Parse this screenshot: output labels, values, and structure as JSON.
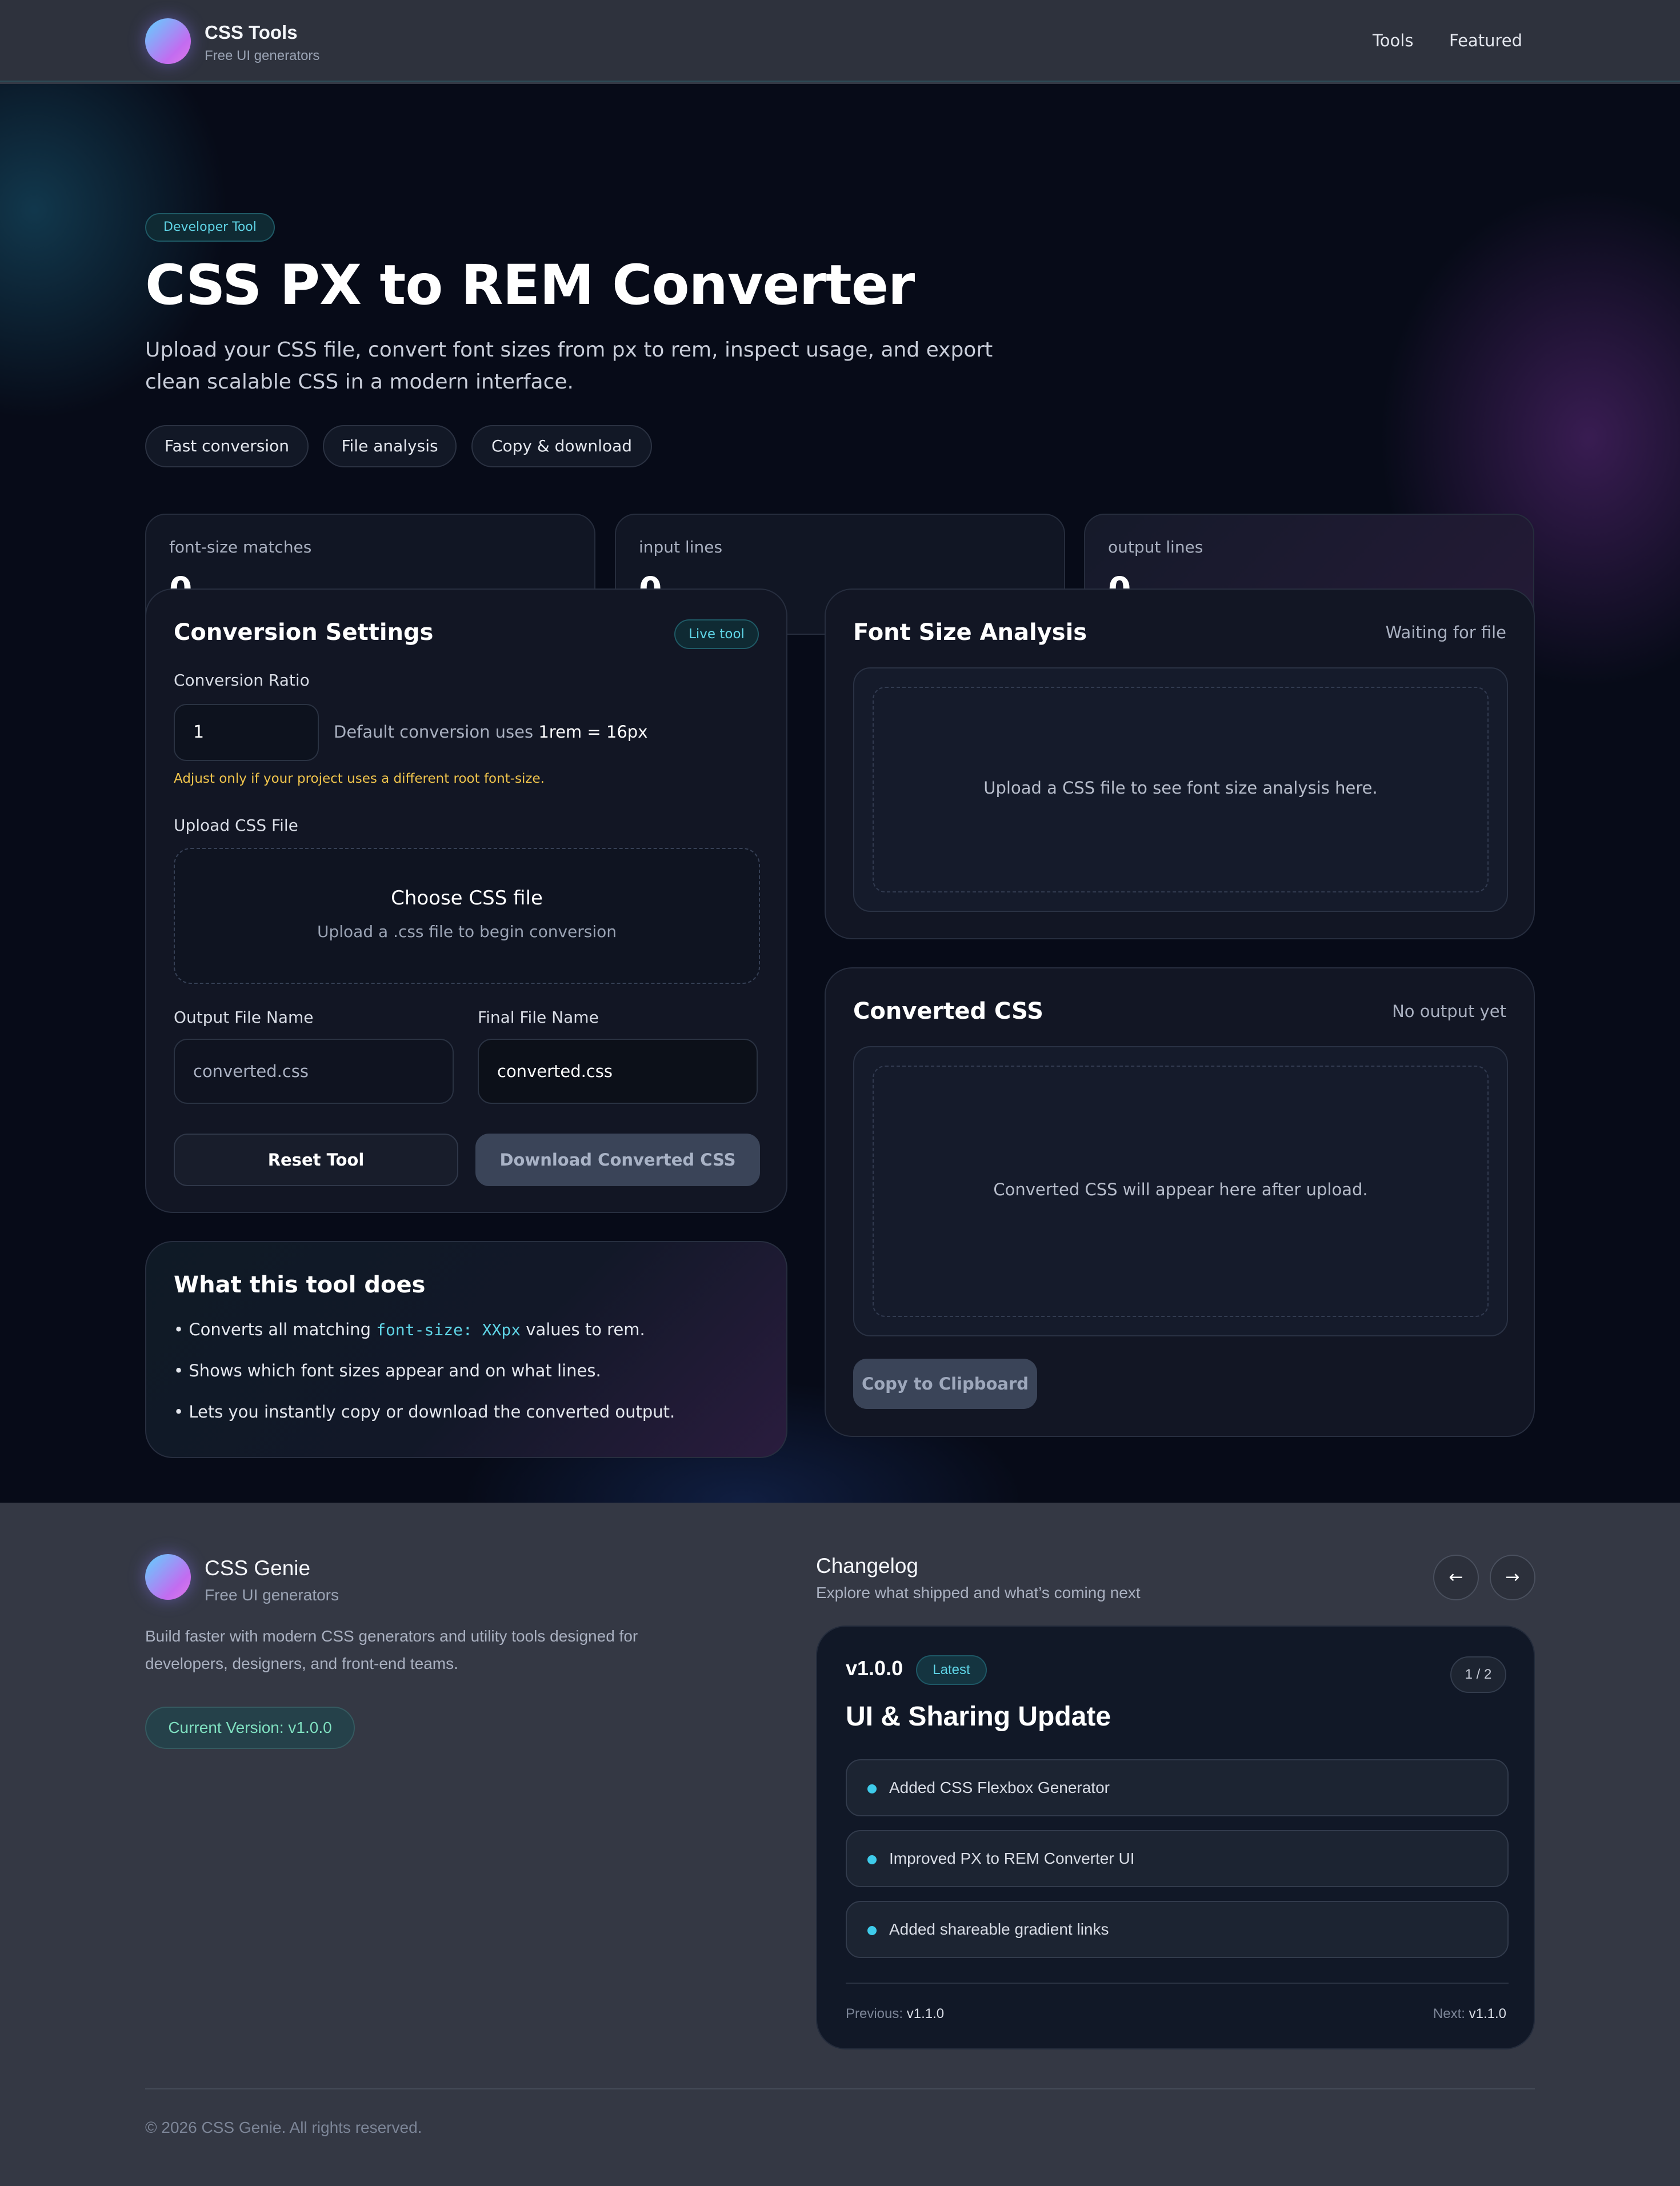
{
  "header": {
    "brand_name": "CSS Tools",
    "brand_sub": "Free UI generators",
    "nav": [
      "Tools",
      "Featured"
    ]
  },
  "hero": {
    "badge": "Developer Tool",
    "title": "CSS PX to REM Converter",
    "description": "Upload your CSS file, convert font sizes from px to rem, inspect usage, and export clean scalable CSS in a modern interface.",
    "chips": [
      "Fast conversion",
      "File analysis",
      "Copy & download"
    ]
  },
  "stats": [
    {
      "label": "font-size matches",
      "value": "0"
    },
    {
      "label": "input lines",
      "value": "0"
    },
    {
      "label": "output lines",
      "value": "0"
    }
  ],
  "settings": {
    "title": "Conversion Settings",
    "badge": "Live tool",
    "ratio_label": "Conversion Ratio",
    "ratio_value": "1",
    "ratio_hint_prefix": "Default conversion uses ",
    "ratio_hint_value": "1rem = 16px",
    "warning": "Adjust only if your project uses a different root font-size.",
    "upload_label": "Upload CSS File",
    "upload_title": "Choose CSS file",
    "upload_sub": "Upload a .css file to begin conversion",
    "output_label": "Output File Name",
    "output_value": "converted.css",
    "final_label": "Final File Name",
    "final_value": "converted.css",
    "reset_button": "Reset Tool",
    "download_button": "Download Converted CSS"
  },
  "what_this_does": {
    "title": "What this tool does",
    "bullet1_prefix": "• Converts all matching ",
    "bullet1_code": "font-size: XXpx",
    "bullet1_suffix": " values to rem.",
    "bullet2": "• Shows which font sizes appear and on what lines.",
    "bullet3": "• Lets you instantly copy or download the converted output."
  },
  "analysis": {
    "title": "Font Size Analysis",
    "status": "Waiting for file",
    "placeholder": "Upload a CSS file to see font size analysis here."
  },
  "converted": {
    "title": "Converted CSS",
    "status": "No output yet",
    "placeholder": "Converted CSS will appear here after upload.",
    "copy_button": "Copy to Clipboard"
  },
  "footer": {
    "brand_name": "CSS Genie",
    "brand_sub": "Free UI generators",
    "description": "Build faster with modern CSS generators and utility tools designed for developers, designers, and front-end teams.",
    "version_pill": "Current Version: v1.0.0",
    "copyright": "© 2026 CSS Genie. All rights reserved."
  },
  "changelog": {
    "title": "Changelog",
    "subtitle": "Explore what shipped and what’s coming next",
    "prev_icon": "arrow-left-icon",
    "next_icon": "arrow-right-icon",
    "version": "v1.0.0",
    "latest_badge": "Latest",
    "page_indicator": "1 / 2",
    "heading": "UI & Sharing Update",
    "items": [
      "Added CSS Flexbox Generator",
      "Improved PX to REM Converter UI",
      "Added shareable gradient links"
    ],
    "previous_label": "Previous:",
    "previous_value": "v1.1.0",
    "next_label": "Next:",
    "next_value": "v1.1.0"
  }
}
